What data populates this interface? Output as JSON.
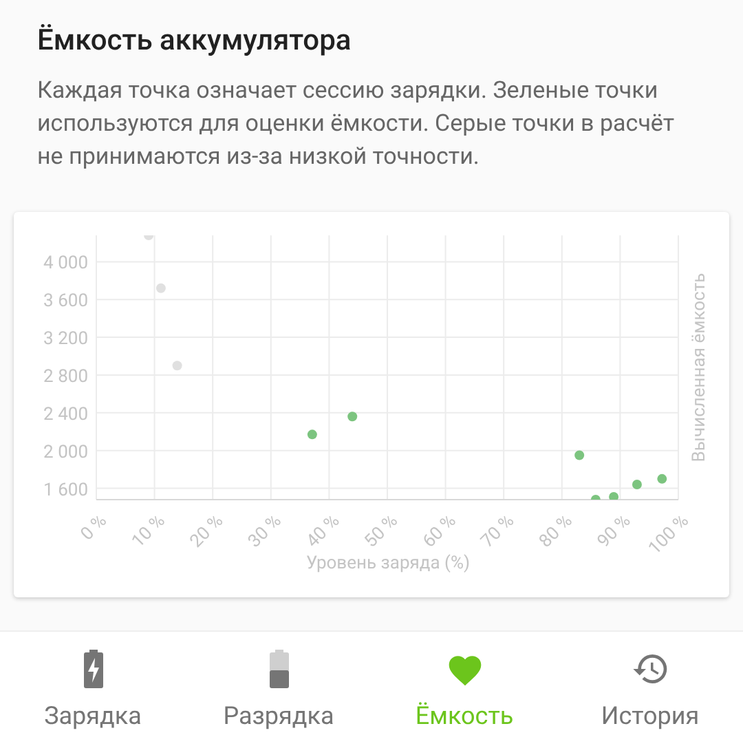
{
  "header": {
    "title": "Ёмкость аккумулятора",
    "description": "Каждая точка означает сессию зарядки. Зеленые точки используются для оценки ёмкости. Серые точки в расчёт не принимаются из-за низкой точности."
  },
  "chart": {
    "chart_data": {
      "type": "scatter",
      "grid": true,
      "xlabel": "Уровень заряда (%)",
      "ylabel": "Вычисленная ёмкость",
      "xlim": [
        0,
        100
      ],
      "ylim": [
        1480,
        4280
      ],
      "xticks": [
        {
          "value": 0,
          "label": "0 %"
        },
        {
          "value": 10,
          "label": "10 %"
        },
        {
          "value": 20,
          "label": "20 %"
        },
        {
          "value": 30,
          "label": "30 %"
        },
        {
          "value": 40,
          "label": "40 %"
        },
        {
          "value": 50,
          "label": "50 %"
        },
        {
          "value": 60,
          "label": "60 %"
        },
        {
          "value": 70,
          "label": "70 %"
        },
        {
          "value": 80,
          "label": "80 %"
        },
        {
          "value": 90,
          "label": "90 %"
        },
        {
          "value": 100,
          "label": "100 %"
        }
      ],
      "yticks": [
        {
          "value": 1600,
          "label": "1 600"
        },
        {
          "value": 2000,
          "label": "2 000"
        },
        {
          "value": 2400,
          "label": "2 400"
        },
        {
          "value": 2800,
          "label": "2 800"
        },
        {
          "value": 3200,
          "label": "3 200"
        },
        {
          "value": 3600,
          "label": "3 600"
        },
        {
          "value": 4000,
          "label": "4 000"
        }
      ],
      "series": [
        {
          "color": "#e0e0e0",
          "x": [
            9,
            11.1,
            13.9
          ],
          "values": [
            4280,
            3720,
            2900
          ]
        },
        {
          "color": "#7cc47f",
          "x": [
            37.1,
            44,
            83,
            85.8,
            88.9,
            92.9,
            97.2
          ],
          "values": [
            2170,
            2360,
            1950,
            1480,
            1510,
            1640,
            1700
          ]
        }
      ]
    }
  },
  "nav": [
    {
      "kind": "charging",
      "label": "Зарядка",
      "selected": false
    },
    {
      "kind": "discharging",
      "label": "Разрядка",
      "selected": false
    },
    {
      "kind": "capacity",
      "label": "Ёмкость",
      "selected": true
    },
    {
      "kind": "history",
      "label": "История",
      "selected": false
    }
  ]
}
